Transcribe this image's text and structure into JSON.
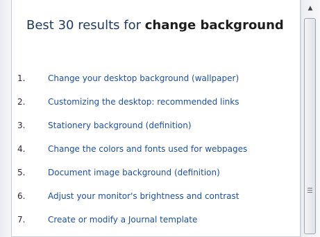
{
  "heading": {
    "prefix": "Best 30 results for ",
    "query": "change background"
  },
  "results": [
    {
      "number": "1.",
      "label": "Change your desktop background (wallpaper)"
    },
    {
      "number": "2.",
      "label": "Customizing the desktop: recommended links"
    },
    {
      "number": "3.",
      "label": "Stationery background (definition)"
    },
    {
      "number": "4.",
      "label": "Change the colors and fonts used for webpages"
    },
    {
      "number": "5.",
      "label": "Document image background (definition)"
    },
    {
      "number": "6.",
      "label": "Adjust your monitor's brightness and contrast"
    },
    {
      "number": "7.",
      "label": "Create or modify a Journal template"
    }
  ],
  "scrollbar": {
    "up_arrow": "▲",
    "thumb_icon": "grip-lines-icon"
  },
  "colors": {
    "link": "#1b4f9f",
    "heading": "#1e395b"
  }
}
